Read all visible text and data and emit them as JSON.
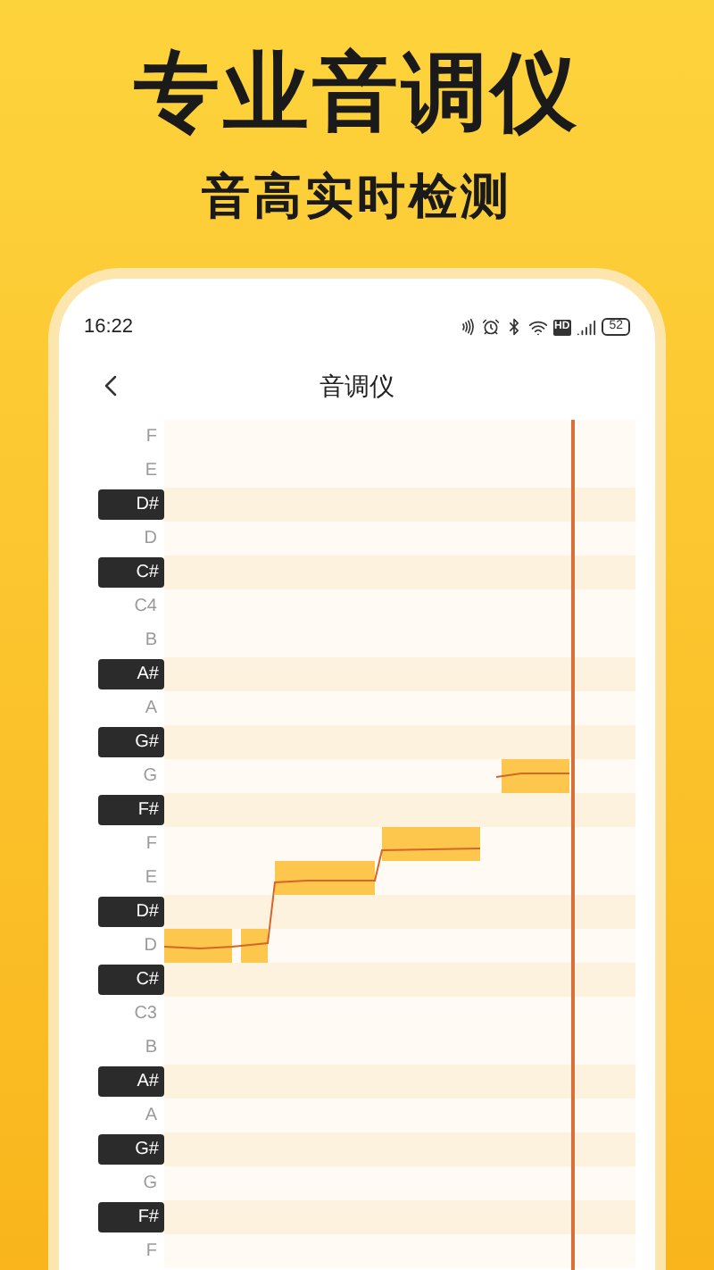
{
  "headline": "专业音调仪",
  "subtitle": "音高实时检测",
  "status_bar": {
    "time": "16:22",
    "hd_badge": "HD",
    "battery": "52"
  },
  "nav": {
    "title": "音调仪"
  },
  "keys": [
    {
      "label": "F",
      "kind": "white"
    },
    {
      "label": "E",
      "kind": "white"
    },
    {
      "label": "D#",
      "kind": "black"
    },
    {
      "label": "D",
      "kind": "white"
    },
    {
      "label": "C#",
      "kind": "black"
    },
    {
      "label": "C4",
      "kind": "white"
    },
    {
      "label": "B",
      "kind": "white"
    },
    {
      "label": "A#",
      "kind": "black"
    },
    {
      "label": "A",
      "kind": "white"
    },
    {
      "label": "G#",
      "kind": "black"
    },
    {
      "label": "G",
      "kind": "white"
    },
    {
      "label": "F#",
      "kind": "black"
    },
    {
      "label": "F",
      "kind": "white"
    },
    {
      "label": "E",
      "kind": "white"
    },
    {
      "label": "D#",
      "kind": "black"
    },
    {
      "label": "D",
      "kind": "white"
    },
    {
      "label": "C#",
      "kind": "black"
    },
    {
      "label": "C3",
      "kind": "white"
    },
    {
      "label": "B",
      "kind": "white"
    },
    {
      "label": "A#",
      "kind": "black"
    },
    {
      "label": "A",
      "kind": "white"
    },
    {
      "label": "G#",
      "kind": "black"
    },
    {
      "label": "G",
      "kind": "white"
    },
    {
      "label": "F#",
      "kind": "black"
    },
    {
      "label": "F",
      "kind": "white"
    }
  ]
}
